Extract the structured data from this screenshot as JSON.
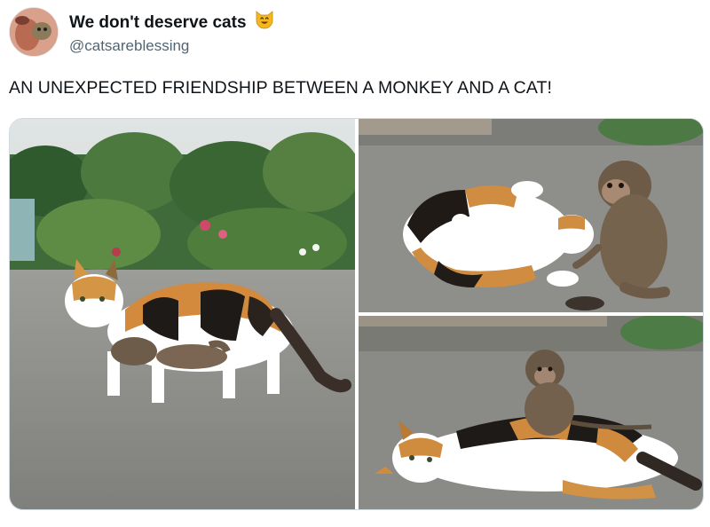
{
  "author": {
    "display_name": "We don't deserve cats",
    "emoji_icon": "smiling-cat-emoji-icon",
    "handle": "@catsareblessing"
  },
  "tweet": {
    "text": "AN UNEXPECTED FRIENDSHIP BETWEEN A MONKEY AND A CAT!"
  },
  "media": {
    "photos": [
      {
        "subject": "calico cat walking with baby monkey clinging underneath"
      },
      {
        "subject": "calico cat lying on its back playing with baby monkey"
      },
      {
        "subject": "baby monkey sitting on calico cat lying on the ground"
      }
    ]
  },
  "colors": {
    "text_primary": "#0f1419",
    "text_secondary": "#536471",
    "border": "#cfd9de"
  }
}
